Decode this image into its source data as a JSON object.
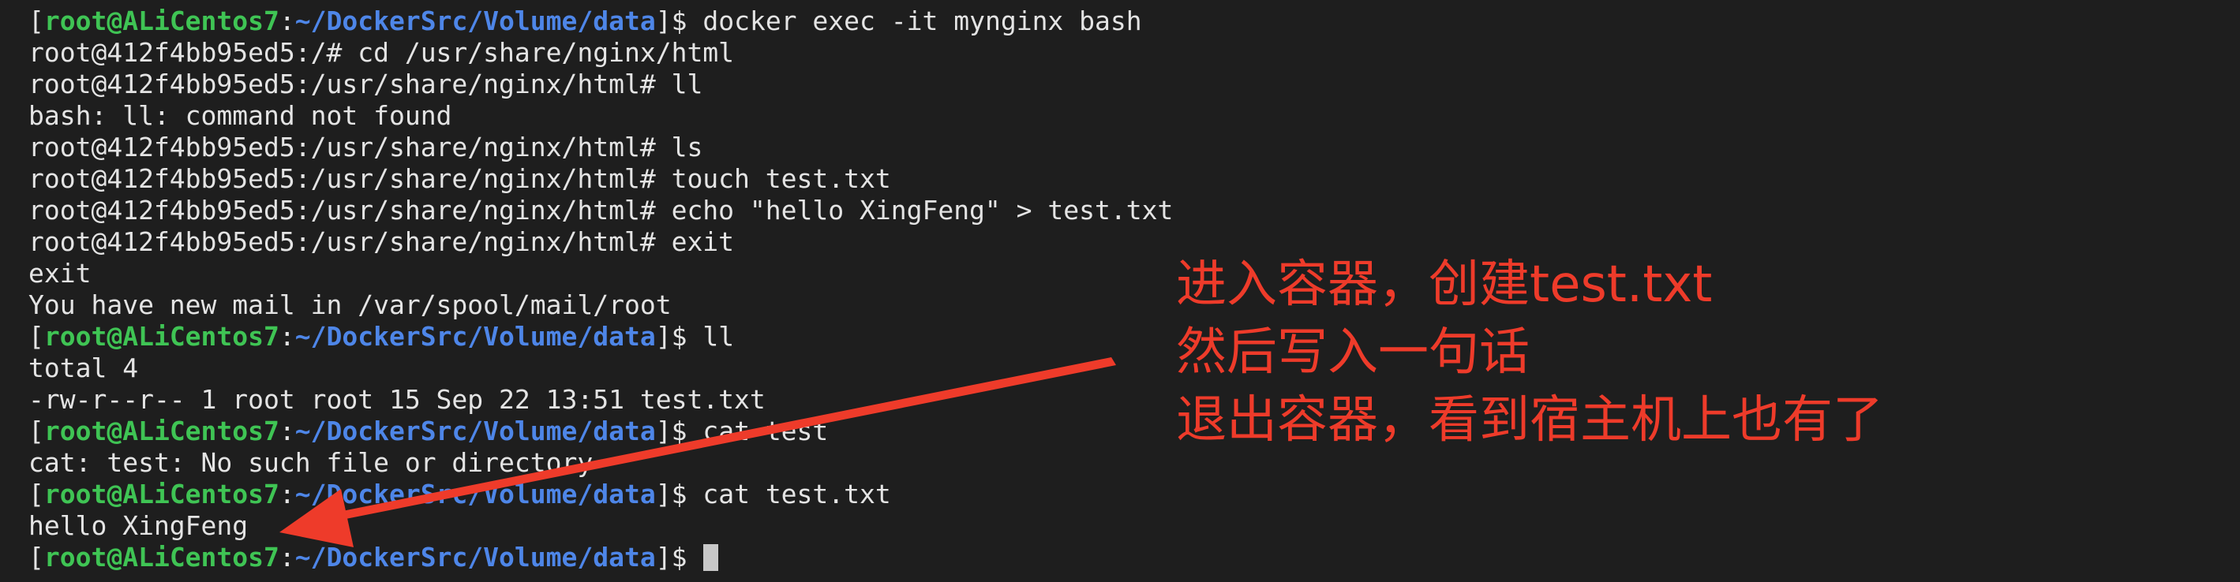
{
  "terminal": {
    "colors": {
      "background": "#1e1e1e",
      "text": "#e4e4e4",
      "prompt_user": "#3fc454",
      "prompt_path": "#4e86e8",
      "annotation": "#ee3b2a"
    },
    "host_prompt": {
      "open_bracket": "[",
      "user_host": "root@ALiCentos7",
      "colon": ":",
      "path": "~/DockerSrc/Volume/data",
      "close_bracket": "]$ "
    },
    "lines": [
      {
        "kind": "host",
        "command": "docker exec -it mynginx bash"
      },
      {
        "kind": "text",
        "text": "root@412f4bb95ed5:/# cd /usr/share/nginx/html"
      },
      {
        "kind": "text",
        "text": "root@412f4bb95ed5:/usr/share/nginx/html# ll"
      },
      {
        "kind": "text",
        "text": "bash: ll: command not found"
      },
      {
        "kind": "text",
        "text": "root@412f4bb95ed5:/usr/share/nginx/html# ls"
      },
      {
        "kind": "text",
        "text": "root@412f4bb95ed5:/usr/share/nginx/html# touch test.txt"
      },
      {
        "kind": "text",
        "text": "root@412f4bb95ed5:/usr/share/nginx/html# echo \"hello XingFeng\" > test.txt"
      },
      {
        "kind": "text",
        "text": "root@412f4bb95ed5:/usr/share/nginx/html# exit"
      },
      {
        "kind": "text",
        "text": "exit"
      },
      {
        "kind": "text",
        "text": "You have new mail in /var/spool/mail/root"
      },
      {
        "kind": "host",
        "command": "ll"
      },
      {
        "kind": "text",
        "text": "total 4"
      },
      {
        "kind": "text",
        "text": "-rw-r--r-- 1 root root 15 Sep 22 13:51 test.txt"
      },
      {
        "kind": "host",
        "command": "cat test"
      },
      {
        "kind": "text",
        "text": "cat: test: No such file or directory"
      },
      {
        "kind": "host",
        "command": "cat test.txt"
      },
      {
        "kind": "text",
        "text": "hello XingFeng"
      },
      {
        "kind": "host",
        "command": "",
        "cursor": true
      }
    ]
  },
  "annotation": {
    "lines": [
      "进入容器，创建test.txt",
      "然后写入一句话",
      "退出容器，看到宿主机上也有了"
    ],
    "arrow_icon": "red-arrow-icon"
  }
}
